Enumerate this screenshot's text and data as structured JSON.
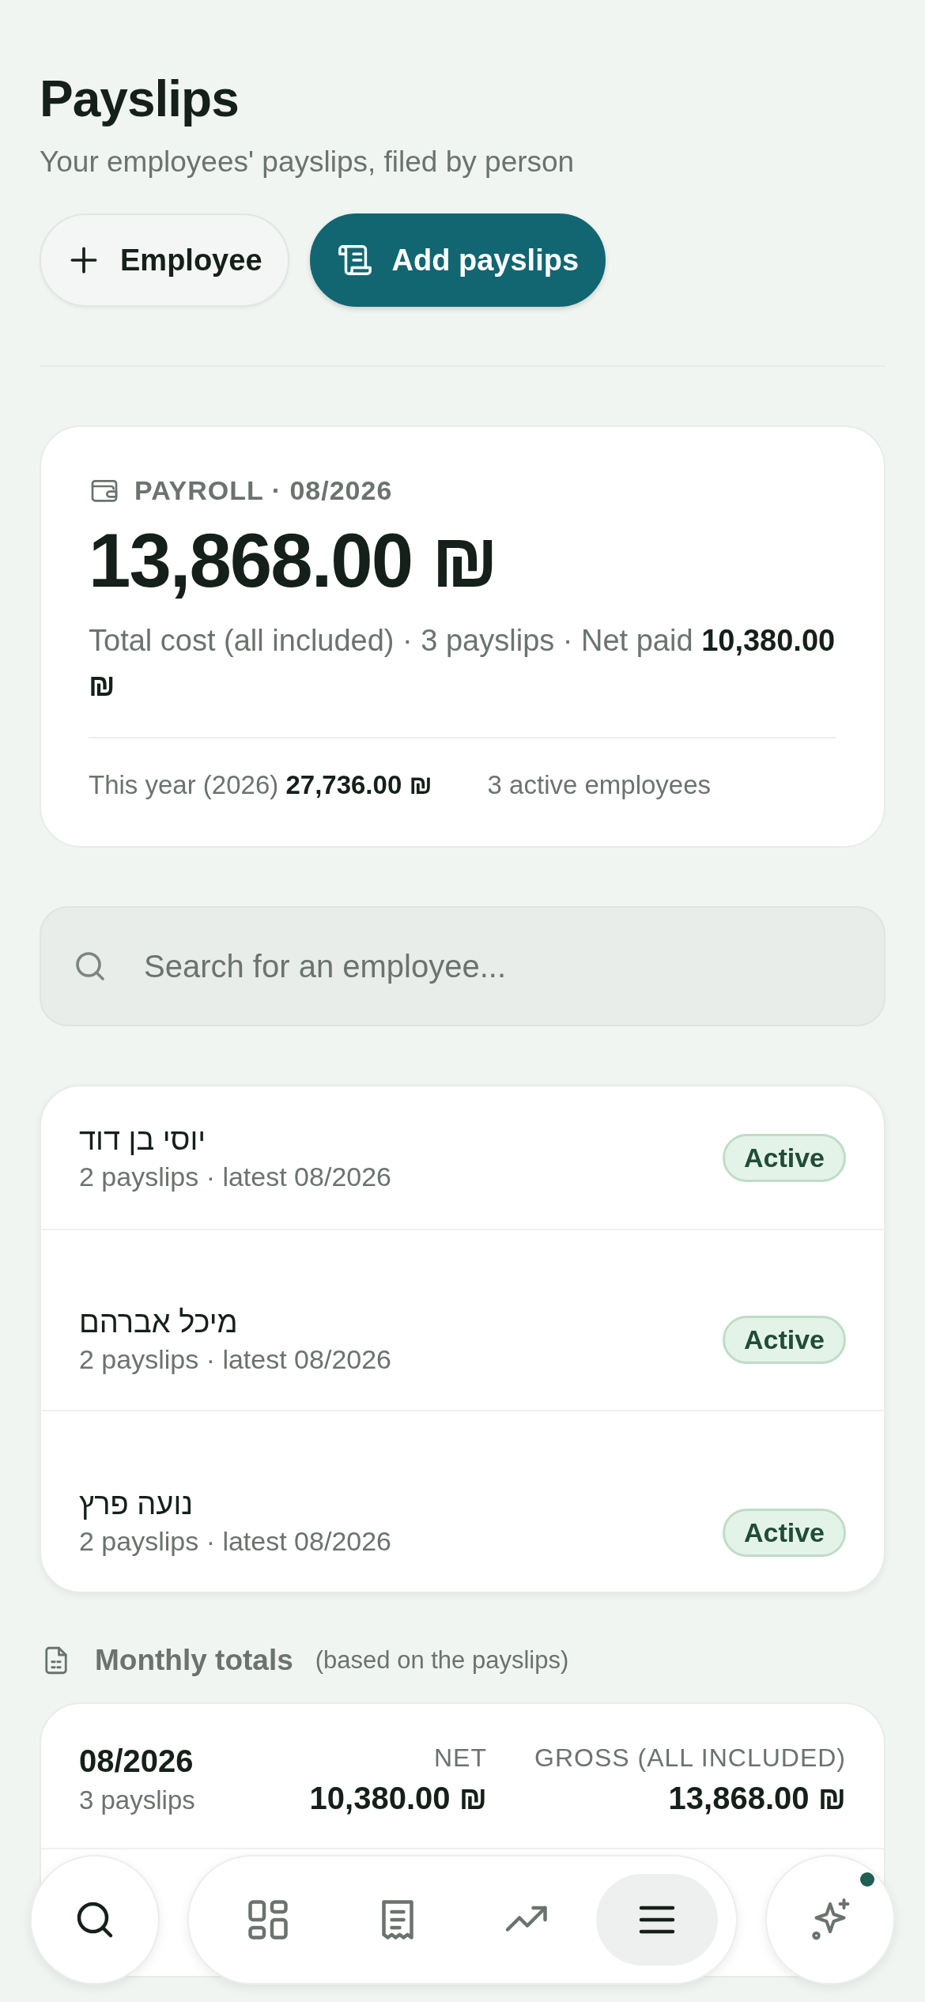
{
  "header": {
    "title": "Payslips",
    "subtitle": "Your employees' payslips, filed by person",
    "buttons": [
      {
        "label": "Employee",
        "kind": "secondary"
      },
      {
        "label": "Add payslips",
        "kind": "primary"
      }
    ]
  },
  "summary": {
    "label": "PAYROLL · 08/2026",
    "total": "13,868.00 ₪",
    "description": "Total cost (all included) · 3 payslips · Net paid **10,380.00 ₪**",
    "year_total": "This year (2026) **27,736.00 ₪**",
    "active_count": "3 active employees"
  },
  "search": {
    "placeholder": "Search for an employee..."
  },
  "employees": [
    {
      "name": "יוסי בן דוד",
      "details": "2 payslips · latest 08/2026",
      "status": "Active"
    },
    {
      "name": "מיכל אברהם",
      "details": "2 payslips · latest 08/2026",
      "status": "Active"
    },
    {
      "name": "נועה פרץ",
      "details": "2 payslips · latest 08/2026",
      "status": "Active"
    }
  ],
  "monthly_totals": {
    "title": "Monthly totals",
    "note": "(based on the payslips)",
    "months": [
      {
        "month": "08/2026",
        "count": "3 payslips",
        "net_label": "NET",
        "net": "10,380.00 ₪",
        "gross_label": "GROSS (ALL INCLUDED)",
        "gross": "13,868.00 ₪"
      }
    ]
  },
  "bottom_nav": {
    "items": [
      {
        "selected": false
      },
      {
        "selected": false
      },
      {
        "selected": false
      },
      {
        "selected": true
      }
    ],
    "assistant": {
      "notification": true
    }
  }
}
